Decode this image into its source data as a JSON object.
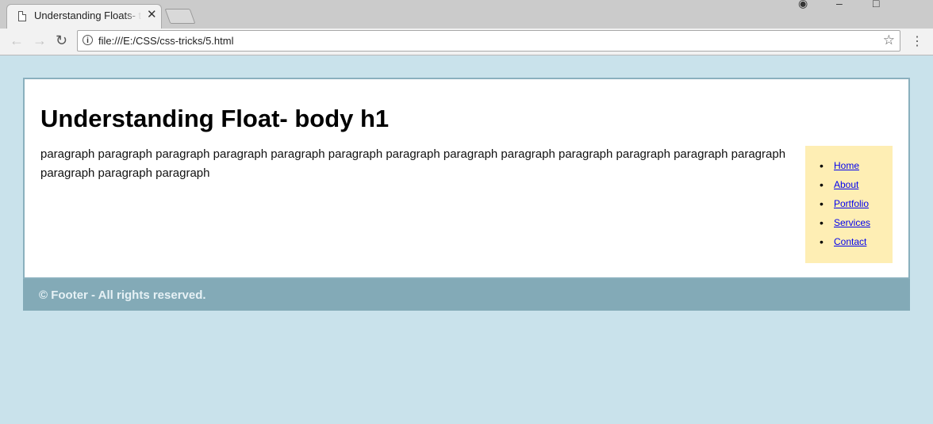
{
  "browser": {
    "tab_title": "Understanding Floats- title",
    "tab_close": "✕",
    "url": "file:///E:/CSS/css-tricks/5.html"
  },
  "icons": {
    "back": "arrow-left-icon",
    "forward": "arrow-right-icon",
    "reload": "reload-icon",
    "info": "info-icon",
    "star": "star-icon",
    "menu": "kebab-menu-icon"
  },
  "page": {
    "heading": "Understanding Float- body h1",
    "paragraph": "paragraph paragraph paragraph paragraph paragraph paragraph paragraph paragraph paragraph paragraph paragraph paragraph paragraph paragraph paragraph paragraph",
    "nav": [
      "Home",
      "About",
      "Portfolio",
      "Services",
      "Contact"
    ],
    "footer": "© Footer - All rights reserved."
  },
  "colors": {
    "background": "#c9e2eb",
    "sidebar": "#feeeb4",
    "footer": "#83aab7",
    "link": "#0000ee"
  }
}
